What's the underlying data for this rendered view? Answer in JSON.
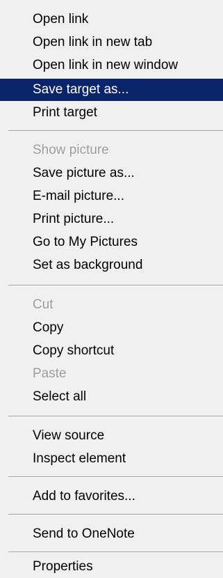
{
  "menu": {
    "highlight_color": "#0a246a",
    "disabled_color": "#9a9a9a",
    "background_color": "#f0f0f0",
    "open_link": "Open link",
    "open_link_new_tab": "Open link in new tab",
    "open_link_new_window": "Open link in new window",
    "save_target_as": "Save target as...",
    "print_target": "Print target",
    "show_picture": "Show picture",
    "save_picture_as": "Save picture as...",
    "email_picture": "E-mail picture...",
    "print_picture": "Print picture...",
    "go_to_my_pictures": "Go to My Pictures",
    "set_as_background": "Set as background",
    "cut": "Cut",
    "copy": "Copy",
    "copy_shortcut": "Copy shortcut",
    "paste": "Paste",
    "select_all": "Select all",
    "view_source": "View source",
    "inspect_element": "Inspect element",
    "add_to_favorites": "Add to favorites...",
    "send_to_onenote": "Send to OneNote",
    "properties": "Properties"
  }
}
